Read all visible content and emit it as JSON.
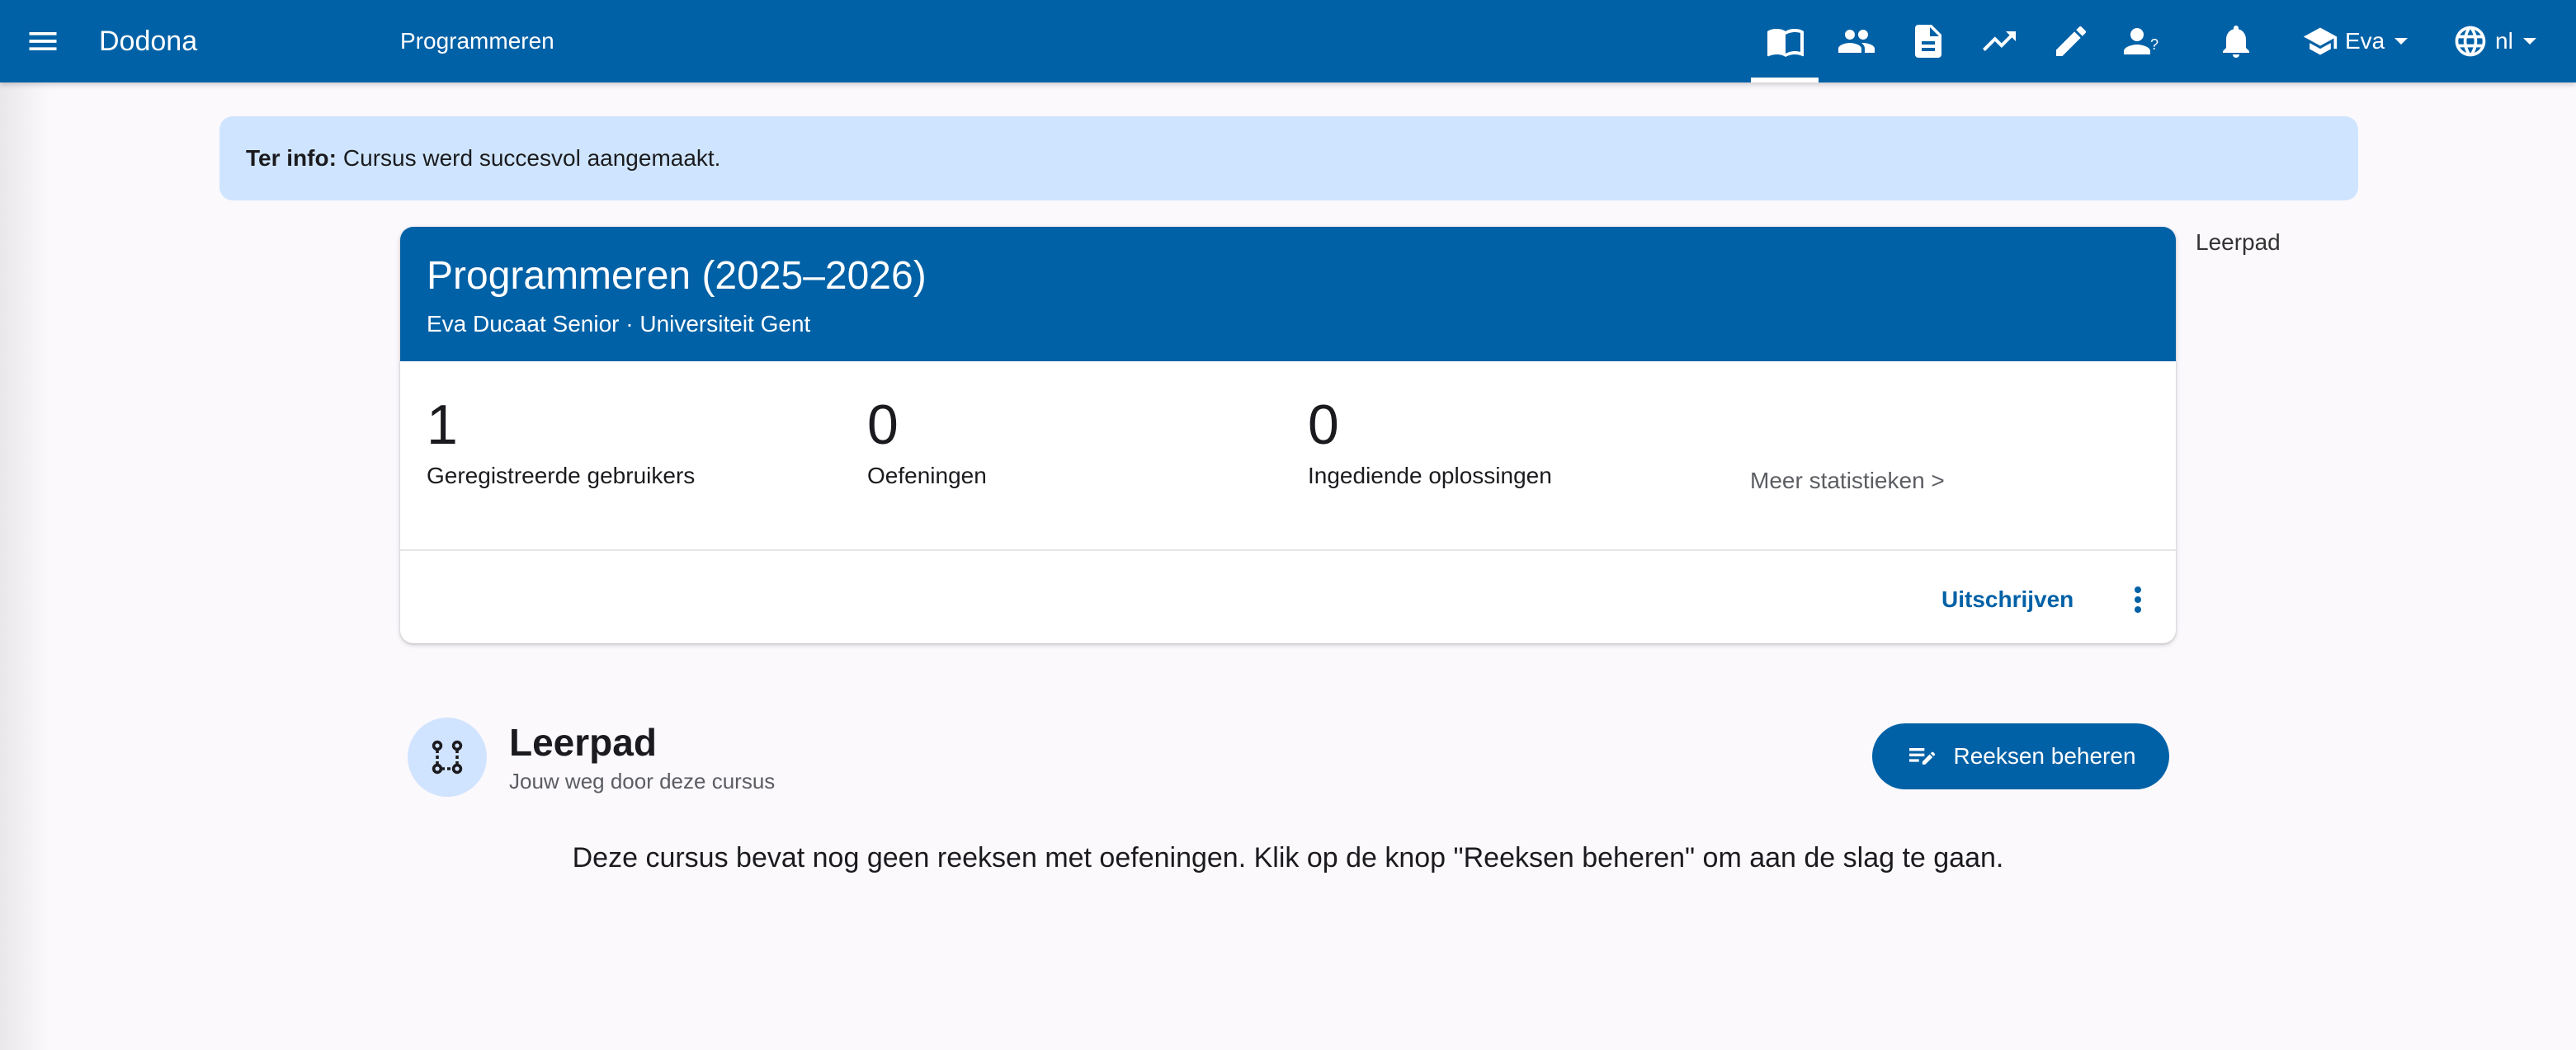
{
  "topbar": {
    "brand": "Dodona",
    "subtitle": "Programmeren",
    "user_name": "Eva",
    "language": "nl",
    "icons": [
      "course-icon",
      "users-icon",
      "submissions-icon",
      "statistics-icon",
      "edit-icon",
      "questions-icon",
      "notifications-icon"
    ]
  },
  "alert": {
    "prefix": "Ter info:",
    "message": "Cursus werd succesvol aangemaakt."
  },
  "course": {
    "title": "Programmeren (2025–2026)",
    "subtitle": "Eva Ducaat Senior · Universiteit Gent",
    "stats": [
      {
        "value": "1",
        "label": "Geregistreerde gebruikers"
      },
      {
        "value": "0",
        "label": "Oefeningen"
      },
      {
        "value": "0",
        "label": "Ingediende oplossingen"
      }
    ],
    "more_stats": "Meer statistieken >",
    "unsubscribe": "Uitschrijven"
  },
  "side_nav": {
    "leerpad_link": "Leerpad"
  },
  "learning_path": {
    "title": "Leerpad",
    "subtitle": "Jouw weg door deze cursus",
    "manage_button": "Reeksen beheren",
    "empty_message": "Deze cursus bevat nog geen reeksen met oefeningen. Klik op de knop \"Reeksen beheren\" om aan de slag te gaan."
  },
  "colors": {
    "primary": "#0061a6",
    "alert_bg": "#cfe5ff",
    "icon_circle": "#d1e4ff"
  }
}
